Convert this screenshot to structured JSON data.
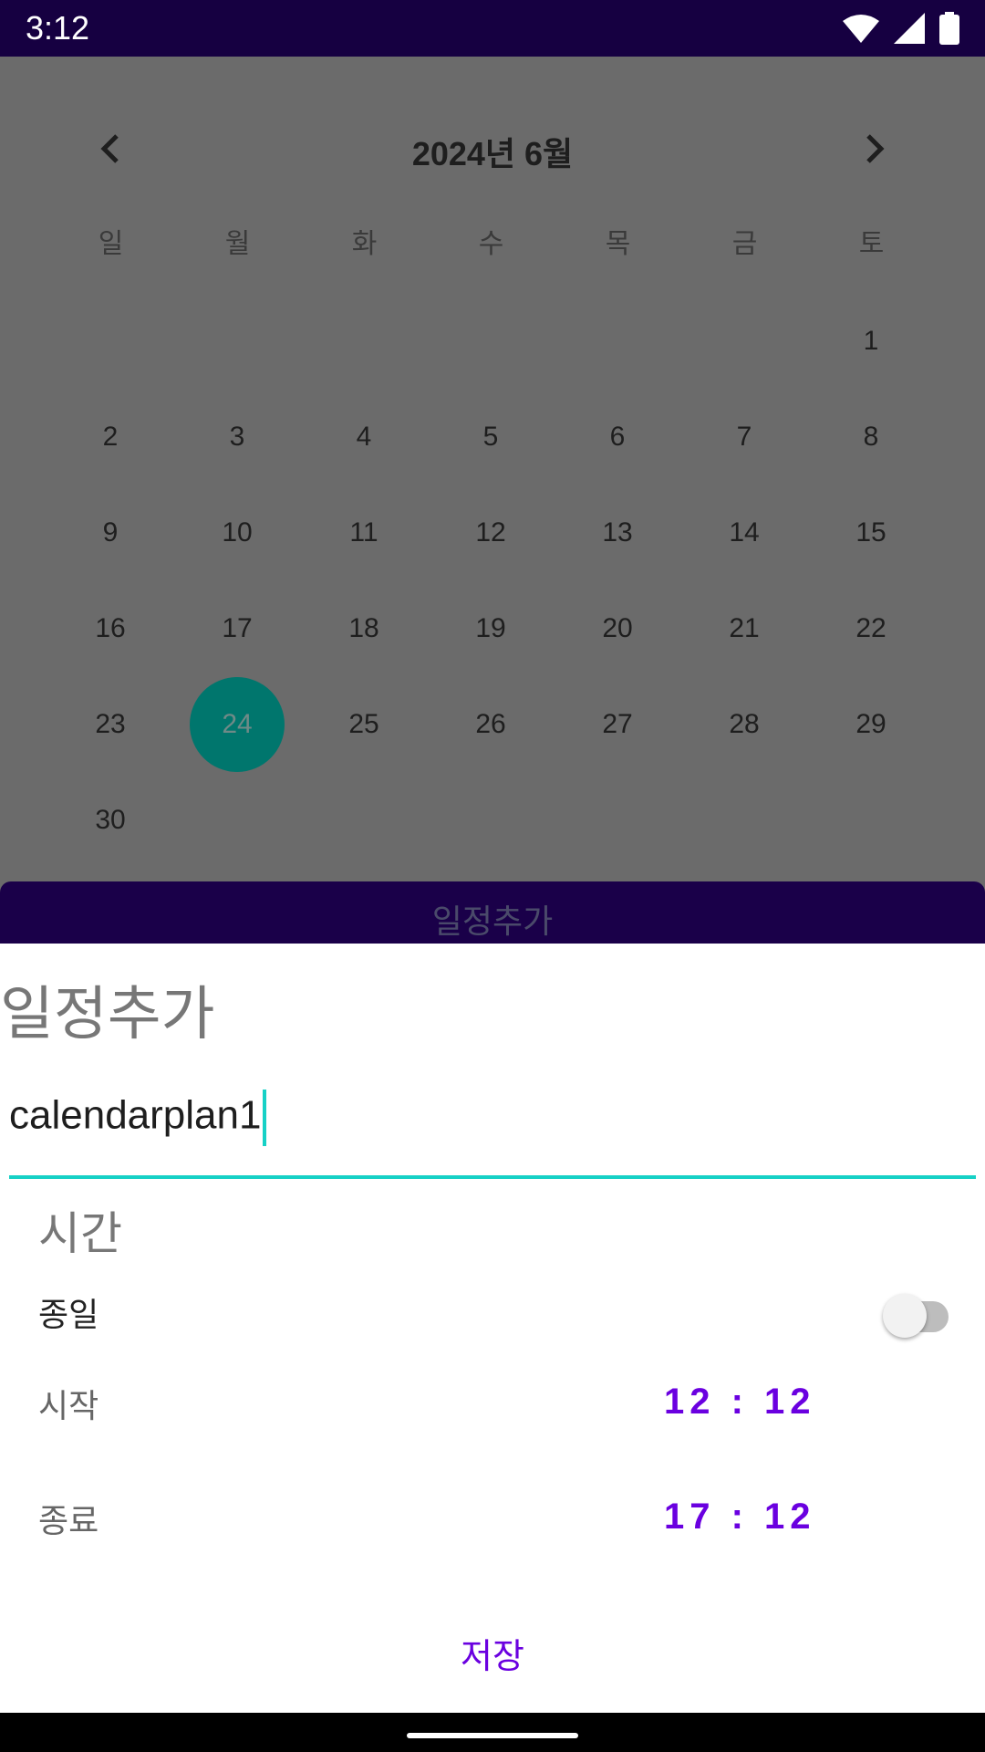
{
  "status_bar": {
    "time": "3:12"
  },
  "calendar": {
    "title": "2024년 6월",
    "weekdays": [
      "일",
      "월",
      "화",
      "수",
      "목",
      "금",
      "토"
    ],
    "days": [
      {
        "day": "1",
        "col": 6,
        "row": 0
      },
      {
        "day": "2",
        "col": 0,
        "row": 1
      },
      {
        "day": "3",
        "col": 1,
        "row": 1
      },
      {
        "day": "4",
        "col": 2,
        "row": 1
      },
      {
        "day": "5",
        "col": 3,
        "row": 1
      },
      {
        "day": "6",
        "col": 4,
        "row": 1
      },
      {
        "day": "7",
        "col": 5,
        "row": 1
      },
      {
        "day": "8",
        "col": 6,
        "row": 1
      },
      {
        "day": "9",
        "col": 0,
        "row": 2
      },
      {
        "day": "10",
        "col": 1,
        "row": 2
      },
      {
        "day": "11",
        "col": 2,
        "row": 2
      },
      {
        "day": "12",
        "col": 3,
        "row": 2
      },
      {
        "day": "13",
        "col": 4,
        "row": 2
      },
      {
        "day": "14",
        "col": 5,
        "row": 2
      },
      {
        "day": "15",
        "col": 6,
        "row": 2
      },
      {
        "day": "16",
        "col": 0,
        "row": 3
      },
      {
        "day": "17",
        "col": 1,
        "row": 3
      },
      {
        "day": "18",
        "col": 2,
        "row": 3
      },
      {
        "day": "19",
        "col": 3,
        "row": 3
      },
      {
        "day": "20",
        "col": 4,
        "row": 3
      },
      {
        "day": "21",
        "col": 5,
        "row": 3
      },
      {
        "day": "22",
        "col": 6,
        "row": 3
      },
      {
        "day": "23",
        "col": 0,
        "row": 4
      },
      {
        "day": "24",
        "col": 1,
        "row": 4,
        "selected": true
      },
      {
        "day": "25",
        "col": 2,
        "row": 4
      },
      {
        "day": "26",
        "col": 3,
        "row": 4
      },
      {
        "day": "27",
        "col": 4,
        "row": 4
      },
      {
        "day": "28",
        "col": 5,
        "row": 4
      },
      {
        "day": "29",
        "col": 6,
        "row": 4
      },
      {
        "day": "30",
        "col": 0,
        "row": 5
      }
    ]
  },
  "bottom_bar": {
    "label": "일정추가"
  },
  "dialog": {
    "title": "일정추가",
    "name_value": "calendarplan1",
    "section_title": "시간",
    "allday_label": "종일",
    "allday_on": false,
    "start_label": "시작",
    "start_time": "12 : 12",
    "end_label": "종료",
    "end_time": "17 : 12",
    "save_label": "저장"
  },
  "colors": {
    "accent": "#6a00e0",
    "teal": "#16d1c6",
    "status_bar": "#160041",
    "selected_day": "#00766d"
  }
}
